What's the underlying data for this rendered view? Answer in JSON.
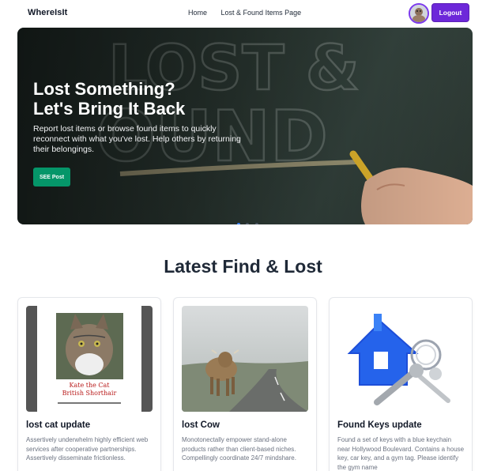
{
  "navbar": {
    "brand": "WhereIsIt",
    "links": [
      "Home",
      "Lost & Found Items Page"
    ],
    "logout_label": "Logout",
    "avatar_icon": "user-avatar",
    "accent": "#6d28d9"
  },
  "hero": {
    "title_line1": "Lost Something?",
    "title_line2": "Let's Bring It Back",
    "description": "Report lost items or browse found items to quickly reconnect with what you've lost. Help others by returning their belongings.",
    "button_label": "SEE Post",
    "button_color": "#059669",
    "slide_count": 3,
    "active_slide": 1
  },
  "latest": {
    "title": "Latest Find & Lost",
    "cards": [
      {
        "title": "lost cat update",
        "description": "Assertively underwhelm highly efficient web services after cooperative partnerships. Assertively disseminate frictionless.",
        "image_caption_line1": "Kate the Cat",
        "image_caption_line2": "British Shorthair"
      },
      {
        "title": "lost Cow",
        "description": "Monotonectally empower stand-alone products rather than client-based niches. Compellingly coordinate 24/7 mindshare."
      },
      {
        "title": "Found Keys update",
        "description": "Found a set of keys with a blue keychain near Hollywood Boulevard. Contains a house key, car key, and a gym tag. Please identify the gym name"
      }
    ]
  }
}
